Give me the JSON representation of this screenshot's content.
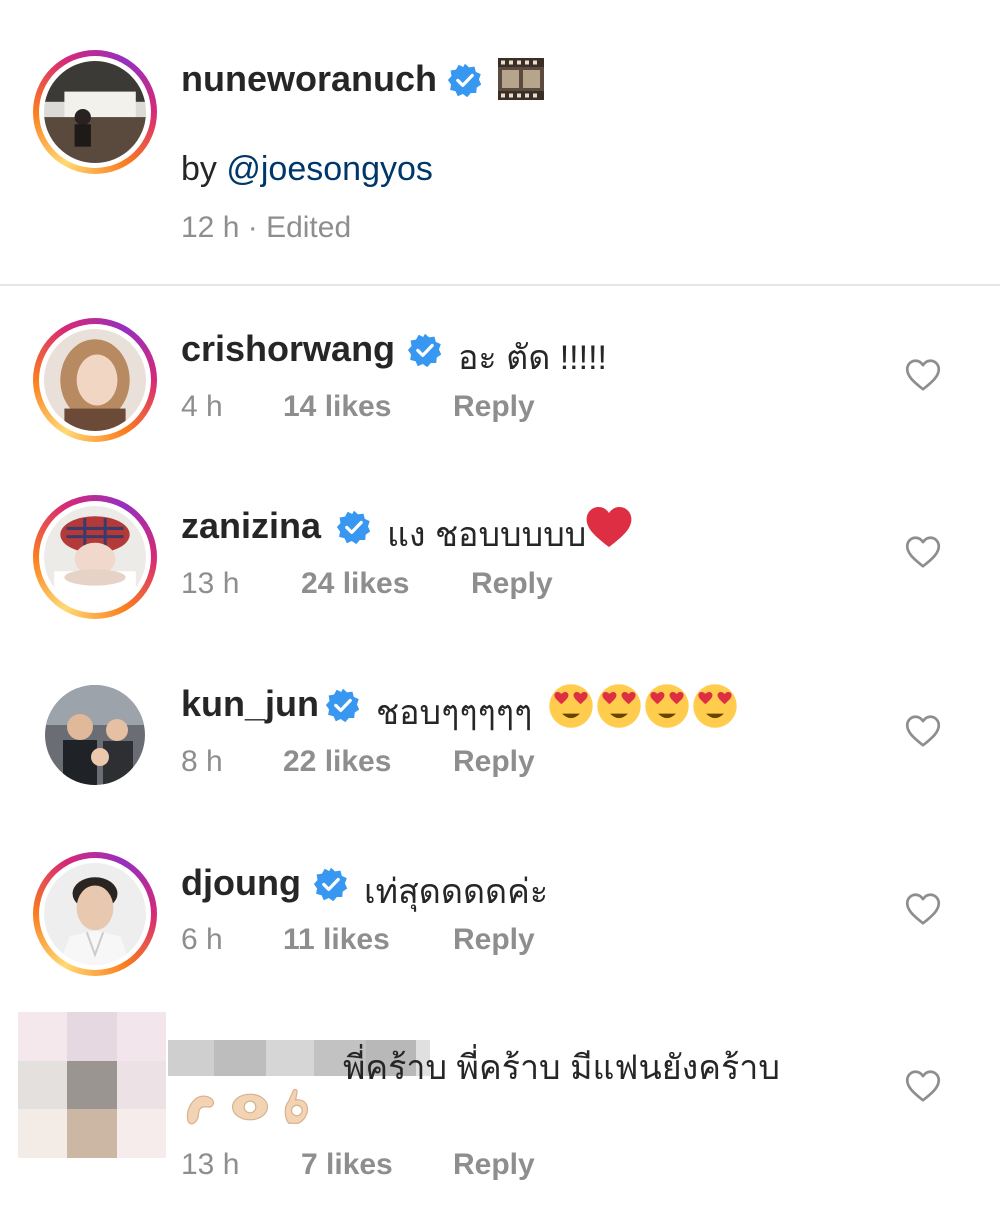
{
  "post_caption": {
    "username": "nuneworanuch",
    "film_icon": "film-frames-icon",
    "by_prefix": "by ",
    "mention": "@joesongyos",
    "time": "12 h",
    "separator": " · ",
    "edited": "Edited"
  },
  "comments": [
    {
      "username": "crishorwang",
      "text": "อะ ตัด !!!!!",
      "time": "4 h",
      "likes": "14 likes",
      "reply": "Reply"
    },
    {
      "username": "zanizina",
      "text": "แง ชอบบบบบ",
      "emoji": "red-heart",
      "time": "13 h",
      "likes": "24 likes",
      "reply": "Reply"
    },
    {
      "username": "kun_jun",
      "text": "ชอบๆๆๆๆๆ",
      "emoji": "heart-eyes x4",
      "time": "8 h",
      "likes": "22 likes",
      "reply": "Reply"
    },
    {
      "username": "djoung",
      "text": "เท่สุดดดดค่ะ",
      "time": "6 h",
      "likes": "11 likes",
      "reply": "Reply"
    },
    {
      "username": "",
      "text": "พี่คร้าบ พี่คร้าบ มีแฟนยังคร้าบ",
      "emoji": "hand-gestures",
      "time": "13 h",
      "likes": "7 likes",
      "reply": "Reply"
    }
  ],
  "colors": {
    "verified_blue": "#3897f0",
    "muted_text": "#8e8e8e",
    "link": "#00376b"
  }
}
